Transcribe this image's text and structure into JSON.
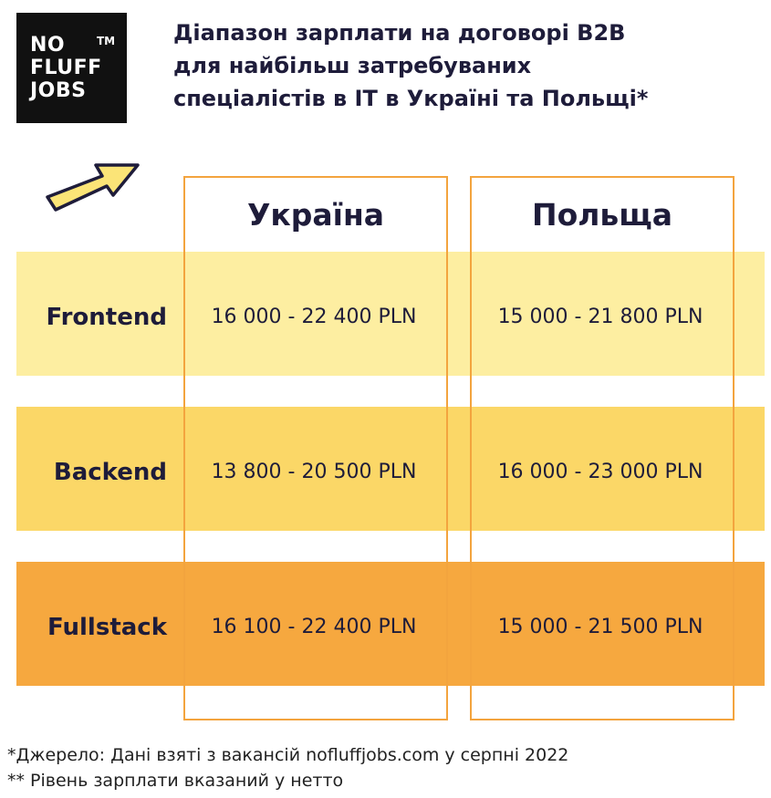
{
  "logo": {
    "line1": "NO",
    "line2": "FLUFF",
    "line3": "JOBS",
    "trademark": "TM"
  },
  "title": {
    "line1": "Діапазон зарплати на договорі B2B",
    "line2": "для найбільш затребуваних",
    "line3": "спеціалістів в IT в Україні та Польщі*"
  },
  "table": {
    "columns": [
      "Україна",
      "Польща"
    ],
    "rows": [
      {
        "label": "Frontend",
        "ukraine": "16 000 - 22 400 PLN",
        "poland": "15 000 - 21 800 PLN",
        "color": "#fdeea1"
      },
      {
        "label": "Backend",
        "ukraine": "13 800 - 20 500 PLN",
        "poland": "16 000 - 23 000 PLN",
        "color": "#fbd767"
      },
      {
        "label": "Fullstack",
        "ukraine": "16 100 - 22 400 PLN",
        "poland": "15 000 - 21 500 PLN",
        "color": "#f6a83f"
      }
    ]
  },
  "footnotes": {
    "source": "*Джерело: Дані взяті з вакансій nofluffjobs.com у серпні 2022",
    "net": "** Рівень зарплати вказаний у нетто"
  },
  "icons": {
    "arrow": "arrow-pointing-up-right-icon"
  },
  "colors": {
    "frame": "#f3a43e",
    "text": "#1e1c3a",
    "logo_bg": "#111111"
  }
}
